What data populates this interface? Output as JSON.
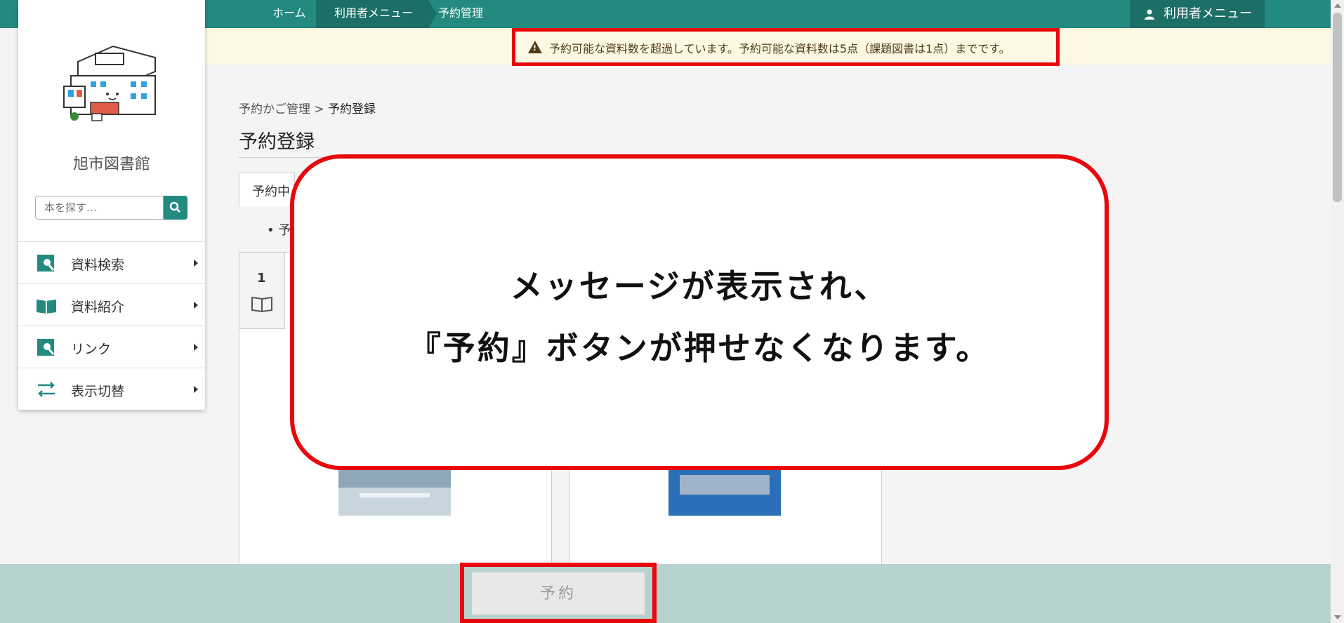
{
  "nav": {
    "breadcrumbs": [
      "ホーム",
      "利用者メニュー",
      "予約管理"
    ],
    "user_menu_label": "利用者メニュー"
  },
  "alert": {
    "message": "予約可能な資料数を超過しています。予約可能な資料数は5点（課題図書は1点）までです。"
  },
  "sidebar": {
    "library_name": "旭市図書館",
    "search_placeholder": "本を探す…",
    "items": [
      {
        "label": "資料検索",
        "icon": "book-search-icon"
      },
      {
        "label": "資料紹介",
        "icon": "open-book-icon"
      },
      {
        "label": "リンク",
        "icon": "link-search-icon"
      },
      {
        "label": "表示切替",
        "icon": "switch-arrows-icon"
      }
    ]
  },
  "main": {
    "breadcrumb_parent": "予約かご管理",
    "breadcrumb_separator": ">",
    "breadcrumb_current": "予約登録",
    "title": "予約登録",
    "tab_label": "予約中",
    "bullet_text": "予",
    "item_number": "1"
  },
  "overlay": {
    "line1": "メッセージが表示され、",
    "line2": "『予約』ボタンが押せなくなります。"
  },
  "footer": {
    "reserve_label": "予約"
  },
  "colors": {
    "teal": "#238a80",
    "highlight_red": "#e8070d",
    "alert_bg": "#fcf8e3"
  }
}
